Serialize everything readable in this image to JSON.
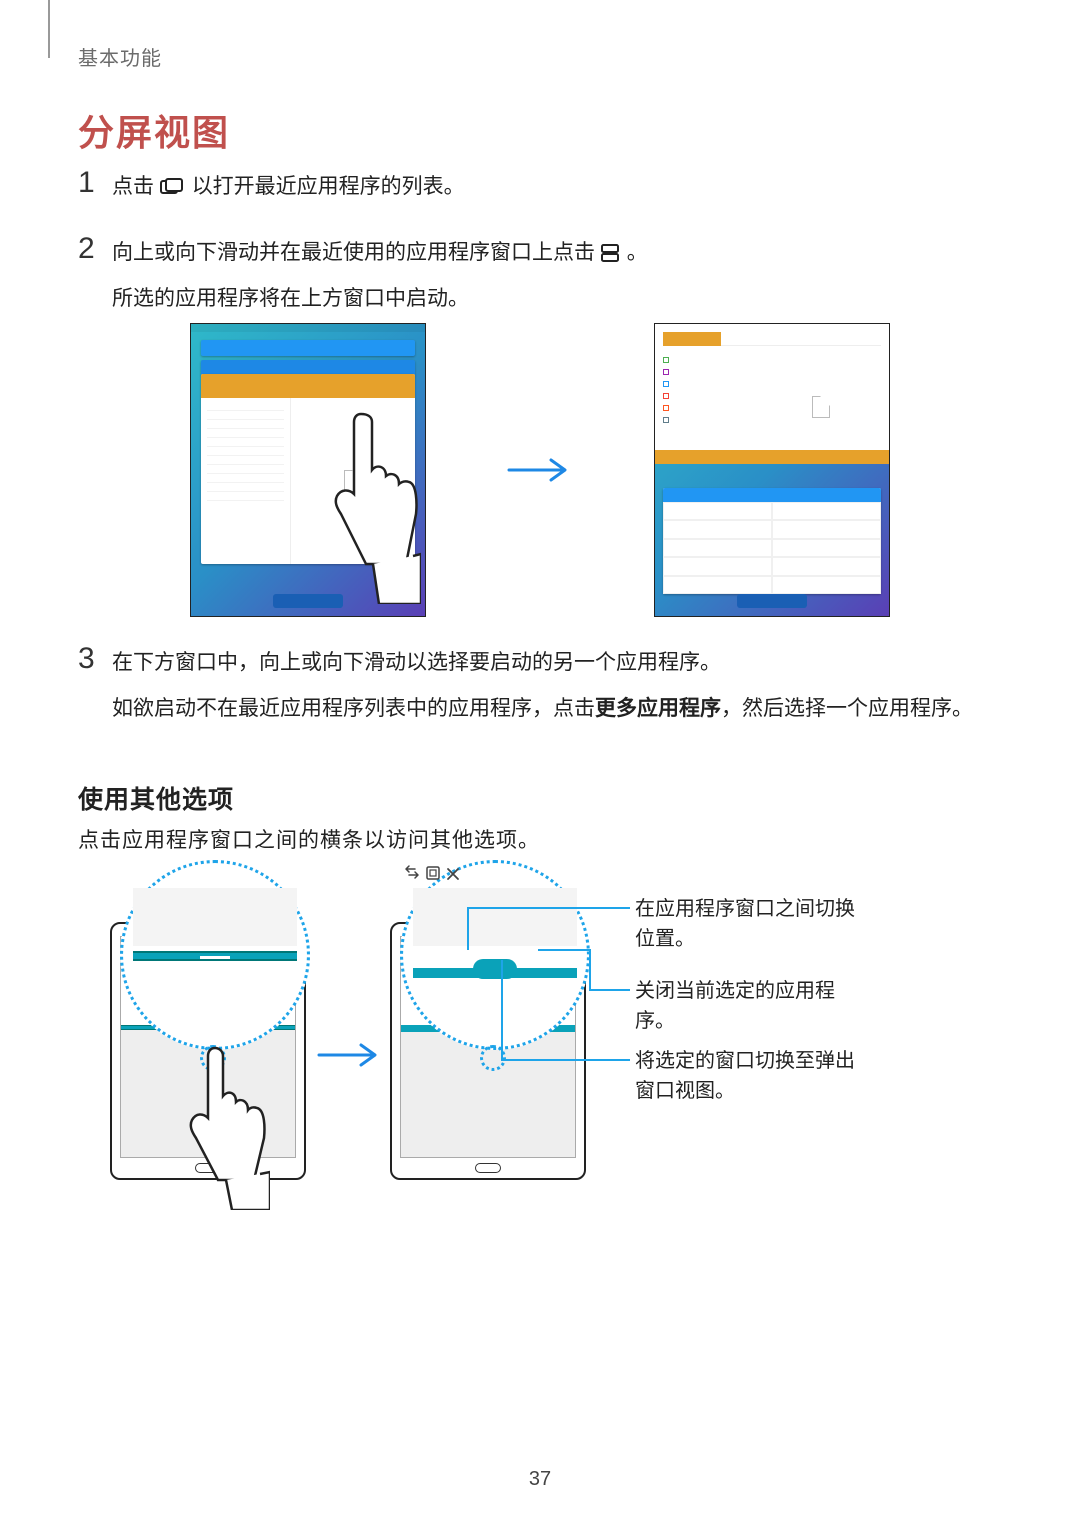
{
  "breadcrumb": "基本功能",
  "heading": "分屏视图",
  "steps": {
    "s1": {
      "num": "1",
      "pre": "点击 ",
      "post": " 以打开最近应用程序的列表。"
    },
    "s2": {
      "num": "2",
      "line1_pre": "向上或向下滑动并在最近使用的应用程序窗口上点击 ",
      "line1_post": "。",
      "line2": "所选的应用程序将在上方窗口中启动。"
    },
    "s3": {
      "num": "3",
      "line1": "在下方窗口中，向上或向下滑动以选择要启动的另一个应用程序。",
      "line2_pre": "如欲启动不在最近应用程序列表中的应用程序，点击",
      "line2_bold": "更多应用程序",
      "line2_post": "，然后选择一个应用程序。"
    }
  },
  "subheading": "使用其他选项",
  "sub_paragraph": "点击应用程序窗口之间的横条以访问其他选项。",
  "callouts": {
    "swap": "在应用程序窗口之间切换位置。",
    "close": "关闭当前选定的应用程序。",
    "popup": "将选定的窗口切换至弹出窗口视图。"
  },
  "page_number": "37"
}
